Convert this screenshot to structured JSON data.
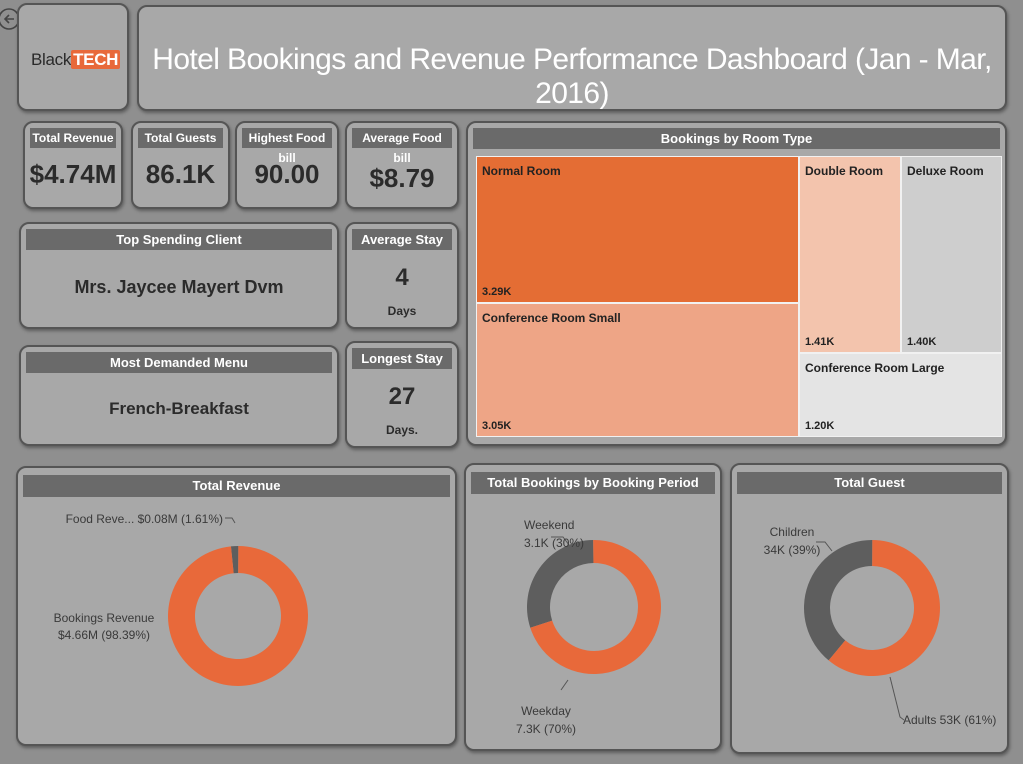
{
  "logo": {
    "part1": "Black",
    "part2": "TECH"
  },
  "title": "Hotel Bookings and Revenue Performance Dashboard (Jan - Mar, 2016)",
  "kpis": [
    {
      "label": "Total Revenue",
      "value": "$4.74M"
    },
    {
      "label": "Total Guests",
      "value": "86.1K"
    },
    {
      "label": "Highest Food bill",
      "value": "90.00"
    },
    {
      "label": "Average Food bill",
      "value": "$8.79"
    }
  ],
  "top_client": {
    "label": "Top Spending Client",
    "value": "Mrs. Jaycee Mayert Dvm"
  },
  "menu": {
    "label": "Most Demanded Menu",
    "value": "French-Breakfast"
  },
  "avg_stay": {
    "label": "Average Stay",
    "value": "4",
    "unit": "Days"
  },
  "longest_stay": {
    "label": "Longest Stay",
    "value": "27",
    "unit": "Days."
  },
  "colors": {
    "accent": "#e8693a",
    "dark": "#5e5e5e",
    "panel": "#a8a8a8",
    "header": "#6a6a6a"
  },
  "chart_data": [
    {
      "type": "treemap",
      "title": "Bookings by Room Type",
      "categories": [
        "Normal Room",
        "Conference Room Small",
        "Double Room",
        "Deluxe Room",
        "Conference Room Large"
      ],
      "values": [
        3290,
        3050,
        1410,
        1400,
        1200
      ],
      "value_labels": [
        "3.29K",
        "3.05K",
        "1.41K",
        "1.40K",
        "1.20K"
      ],
      "colors": [
        "#e46d34",
        "#eea586",
        "#f3c4ad",
        "#cecece",
        "#e4e4e4"
      ]
    },
    {
      "type": "pie",
      "title": "Total Revenue",
      "categories": [
        "Food Reve...",
        "Bookings Revenue"
      ],
      "values": [
        0.08,
        4.66
      ],
      "percent": [
        1.61,
        98.39
      ],
      "value_labels": [
        "$0.08M (1.61%)",
        "$4.66M (98.39%)"
      ],
      "colors": [
        "#5e5e5e",
        "#e8693a"
      ]
    },
    {
      "type": "pie",
      "title": "Total Bookings by Booking Period",
      "categories": [
        "Weekend",
        "Weekday"
      ],
      "values": [
        3.1,
        7.3
      ],
      "percent": [
        30,
        70
      ],
      "value_labels": [
        "3.1K (30%)",
        "7.3K (70%)"
      ],
      "colors": [
        "#5e5e5e",
        "#e8693a"
      ]
    },
    {
      "type": "pie",
      "title": "Total Guest",
      "categories": [
        "Children",
        "Adults"
      ],
      "values": [
        34,
        53
      ],
      "percent": [
        39,
        61
      ],
      "value_labels": [
        "34K (39%)",
        "53K (61%)"
      ],
      "colors": [
        "#5e5e5e",
        "#e8693a"
      ]
    }
  ]
}
